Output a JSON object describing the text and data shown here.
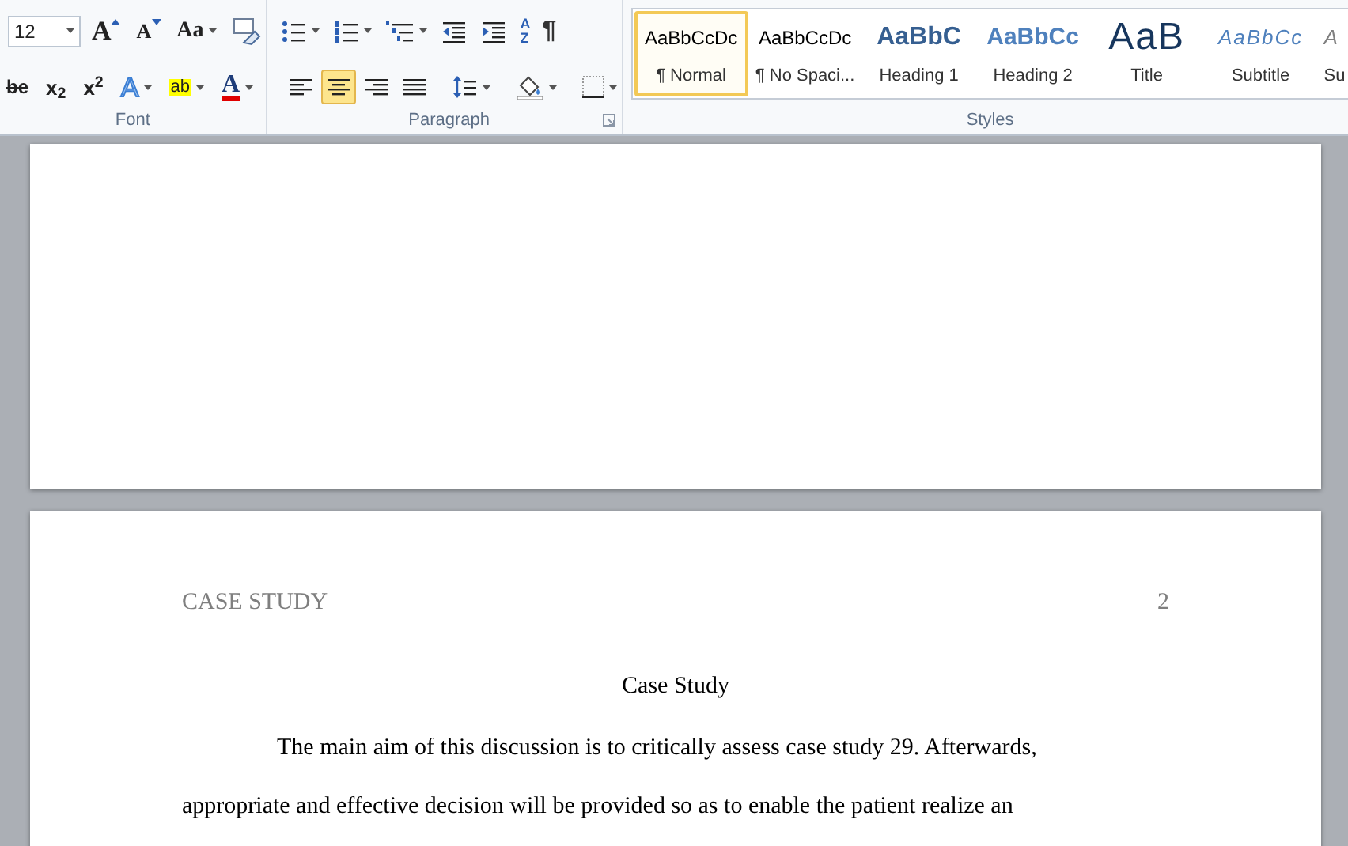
{
  "ribbon": {
    "font_group": {
      "label": "Font",
      "font_size": "12",
      "row1": [
        {
          "kind": "grow",
          "glyph": "A"
        },
        {
          "kind": "shrink",
          "glyph": "A"
        },
        {
          "kind": "case",
          "glyph": "Aa"
        },
        {
          "kind": "clear"
        }
      ],
      "row2": [
        {
          "kind": "strike",
          "glyph": "be"
        },
        {
          "kind": "subscript",
          "glyph": "x$_{2}$"
        },
        {
          "kind": "superscript",
          "glyph": "x$^{2}$"
        },
        {
          "kind": "effects",
          "glyph": "A"
        },
        {
          "kind": "highlight",
          "glyph": "ab"
        },
        {
          "kind": "font_color",
          "glyph": "A"
        }
      ]
    },
    "paragraph_group": {
      "label": "Paragraph",
      "row1": [
        {
          "kind": "bullets"
        },
        {
          "kind": "numbering"
        },
        {
          "kind": "multilevel"
        },
        {
          "kind": "outdent"
        },
        {
          "kind": "indent"
        },
        {
          "kind": "sort",
          "glyph": "AZ"
        },
        {
          "kind": "pilcrow",
          "glyph": "¶"
        }
      ],
      "alignment": [
        {
          "kind": "left",
          "selected": false
        },
        {
          "kind": "center",
          "selected": true
        },
        {
          "kind": "right",
          "selected": false
        },
        {
          "kind": "justify",
          "selected": false
        }
      ],
      "row2": [
        {
          "kind": "line_spacing"
        },
        {
          "kind": "shading"
        },
        {
          "kind": "borders"
        }
      ]
    },
    "styles_group": {
      "label": "Styles",
      "items": [
        {
          "kind": "normal",
          "preview": "AaBbCcDc",
          "name": "¶ Normal",
          "selected": true
        },
        {
          "kind": "normal",
          "preview": "AaBbCcDc",
          "name": "¶ No Spaci...",
          "selected": false
        },
        {
          "kind": "heading1",
          "preview": "AaBbC",
          "name": "Heading 1",
          "selected": false
        },
        {
          "kind": "heading2",
          "preview": "AaBbCc",
          "name": "Heading 2",
          "selected": false
        },
        {
          "kind": "title",
          "preview": "AaB",
          "name": "Title",
          "selected": false
        },
        {
          "kind": "subtitle",
          "preview": "AaBbCc",
          "name": "Subtitle",
          "selected": false
        },
        {
          "kind": "subtle",
          "preview": "A",
          "name": "Su",
          "selected": false
        }
      ]
    }
  },
  "document": {
    "header": "CASE STUDY",
    "page_number": "2",
    "title": "Case Study",
    "paragraphs": [
      "The main aim of this discussion is to critically assess case study 29. Afterwards, appropriate and effective decision will be provided so as to enable the patient realize an"
    ]
  }
}
